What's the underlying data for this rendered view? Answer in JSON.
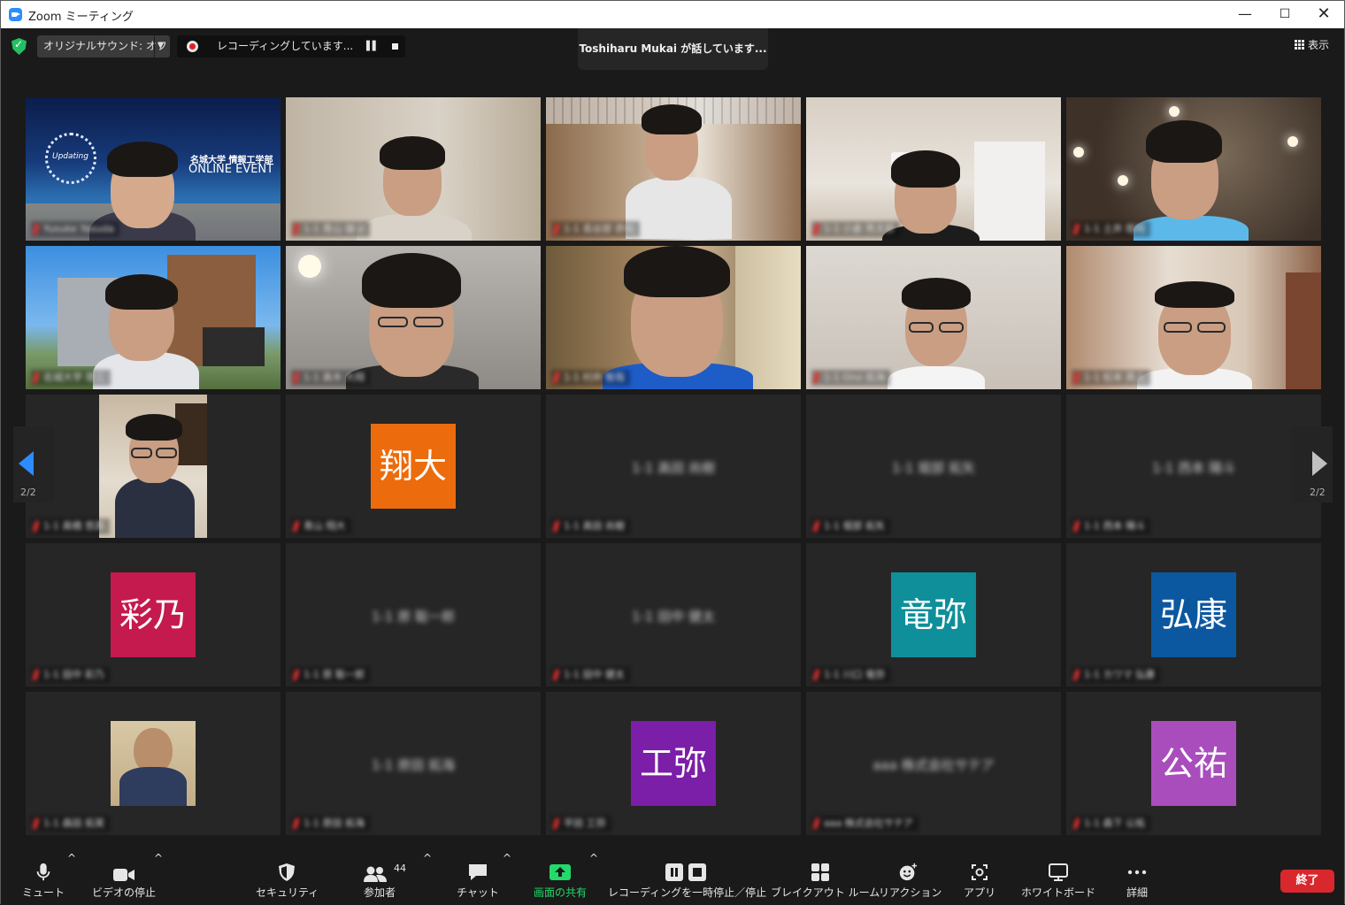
{
  "window": {
    "title": "Zoom ミーティング"
  },
  "topbar": {
    "original_sound": "オリジナルサウンド: オフ",
    "recording": "レコーディングしています...",
    "speaking": "Toshiharu  Mukai が話しています...",
    "view": "表示"
  },
  "navigation": {
    "page_left": "2/2",
    "page_right": "2/2"
  },
  "banner": {
    "university": "名城大学 情報工学部",
    "event": "ONLINE EVENT",
    "logo_text": "Updating"
  },
  "avatars": [
    "翔大",
    "彩乃",
    "竜弥",
    "弘康",
    "工弥",
    "公祐"
  ],
  "colors": {
    "accent": "#2d8cff",
    "avatar_orange": "#ec6b0c",
    "avatar_crimson": "#c41a4e",
    "avatar_teal": "#0e8f9a",
    "avatar_blue": "#0b58a0",
    "avatar_purple": "#7b1ea8",
    "avatar_violet": "#a94dbd",
    "end_red": "#d9282d",
    "share_green": "#23d96c"
  },
  "toolbar": {
    "mute": "ミュート",
    "video": "ビデオの停止",
    "security": "セキュリティ",
    "participants": "参加者",
    "participant_count": "44",
    "chat": "チャット",
    "share": "画面の共有",
    "record": "レコーディングを一時停止／停止",
    "breakout": "ブレイクアウト ルーム",
    "reactions": "リアクション",
    "apps": "アプリ",
    "whiteboard": "ホワイトボード",
    "more": "詳細",
    "end": "終了"
  }
}
